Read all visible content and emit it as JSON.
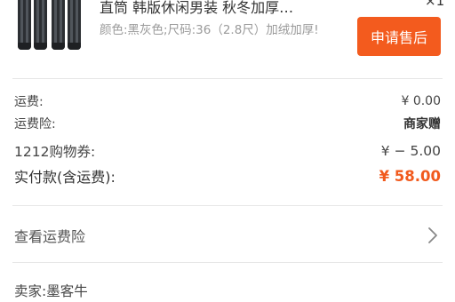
{
  "product": {
    "image_icon": "pants-thumbnail-icon",
    "title": "直筒 韩版休闲男装 秋冬加厚…",
    "quantity": "×1",
    "spec": "颜色:黑灰色;尺码:36（2.8尺）加绒加厚!",
    "refund_button": "申请售后"
  },
  "fees": {
    "shipping_label": "运费:",
    "shipping_value": "¥ 0.00",
    "insurance_label": "运费险:",
    "insurance_value": "商家赠",
    "coupon_label": "1212购物券:",
    "coupon_value": "¥ − 5.00",
    "paid_label": "实付款(含运费):",
    "paid_value": "¥ 58.00"
  },
  "insurance_link": {
    "label": "查看运费险",
    "icon": "chevron-right-icon"
  },
  "seller": {
    "label": "卖家:墨客牛"
  },
  "colors": {
    "accent": "#f35b1e",
    "price": "#f15a1d",
    "muted": "#9a9a9a"
  }
}
